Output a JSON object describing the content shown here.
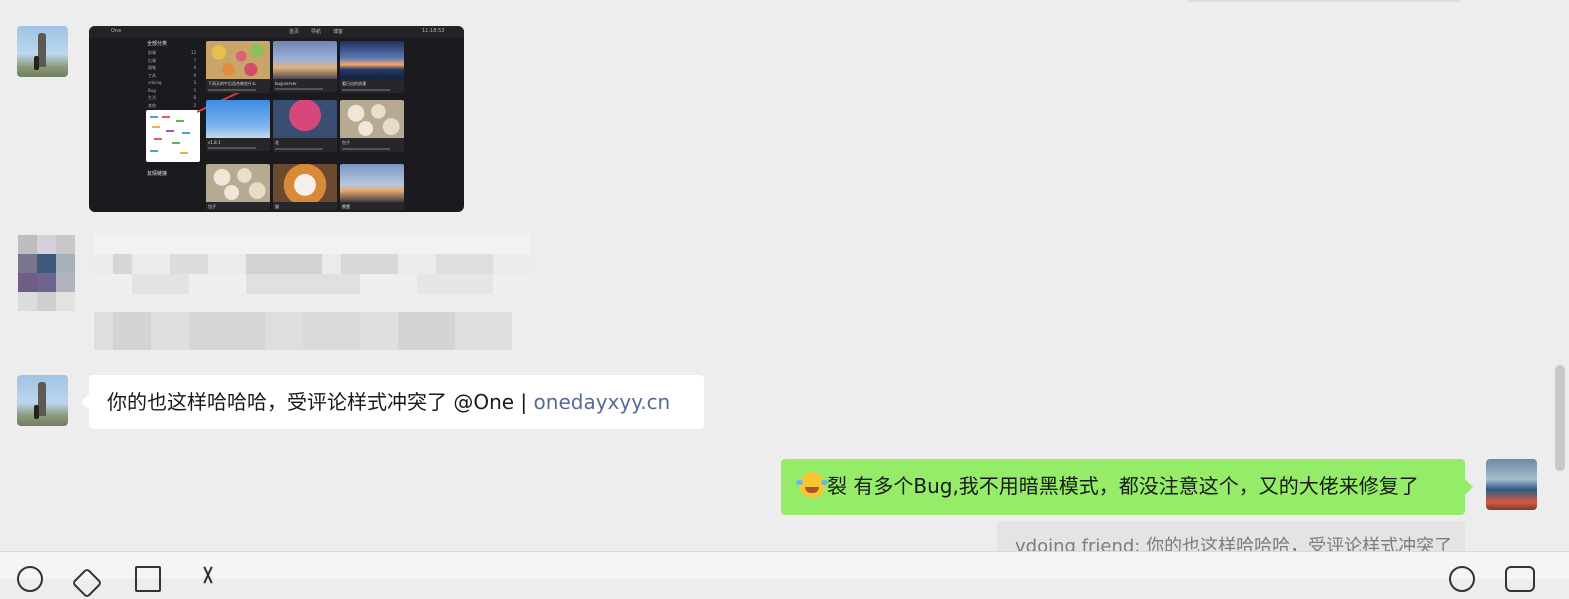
{
  "messages": [
    {
      "type": "image",
      "sender": "left",
      "image": {
        "topbar_left": "One",
        "topbar_tabs": [
          "首页",
          "导航",
          "博客"
        ],
        "topbar_time": "11:18:53",
        "sidebar_title": "全部分类",
        "sidebar_items": [
          {
            "name": "前端",
            "count": "12"
          },
          {
            "name": "后端",
            "count": "7"
          },
          {
            "name": "随笔",
            "count": "4"
          },
          {
            "name": "工具",
            "count": "9"
          },
          {
            "name": "vdoing",
            "count": "3"
          },
          {
            "name": "Bug",
            "count": "5"
          },
          {
            "name": "生活",
            "count": "8"
          },
          {
            "name": "其他",
            "count": "2"
          }
        ],
        "recommend_title": "友情链接",
        "cards": [
          {
            "caption": "下雨天的午后适合做些什么",
            "img": "img-eggs"
          },
          {
            "caption": "bug-server",
            "img": "img-fire"
          },
          {
            "caption": "看日出的浪漫",
            "img": "img-sea"
          },
          {
            "caption": "v1.8.1",
            "img": "img-sky"
          },
          {
            "caption": "花",
            "img": "img-tree"
          },
          {
            "caption": "包子",
            "img": "img-dump"
          },
          {
            "caption": "包子",
            "img": "img-dump"
          },
          {
            "caption": "猫",
            "img": "img-cat"
          },
          {
            "caption": "晚霞",
            "img": "img-fire2"
          }
        ]
      }
    },
    {
      "type": "text",
      "sender": "left",
      "text": "你的也这样哈哈哈，受评论样式冲突了 @One | ",
      "link": "onedayxyy.cn"
    },
    {
      "type": "text",
      "sender": "right",
      "emoji": "laugh-cry-emoji",
      "text": "裂 有多个Bug,我不用暗黑模式，都没注意这个，又的大佬来修复了",
      "quote": "vdoing friend: 你的也这样哈哈哈，受评论样式冲突了"
    }
  ],
  "colors": {
    "background": "#ededed",
    "bubble_incoming": "#ffffff",
    "bubble_outgoing": "#95ec69",
    "link": "#576b95"
  },
  "toolbar": {
    "left_icons": [
      "emoji-icon",
      "favorite-icon",
      "folder-icon",
      "scissors-icon"
    ],
    "right_icons": [
      "call-icon",
      "video-icon"
    ]
  }
}
